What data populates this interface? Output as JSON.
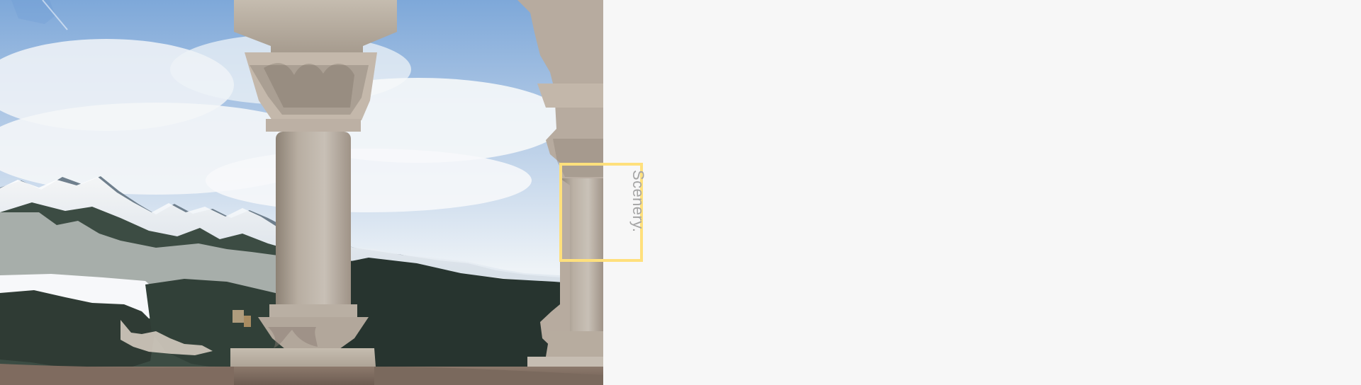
{
  "caption": {
    "text": "Scenery."
  },
  "icons": {
    "photo": "landscape-photo-icon"
  },
  "colors": {
    "frame": "#ffe07c",
    "caption": "#a5a5a5",
    "background": "#f7f7f7"
  }
}
